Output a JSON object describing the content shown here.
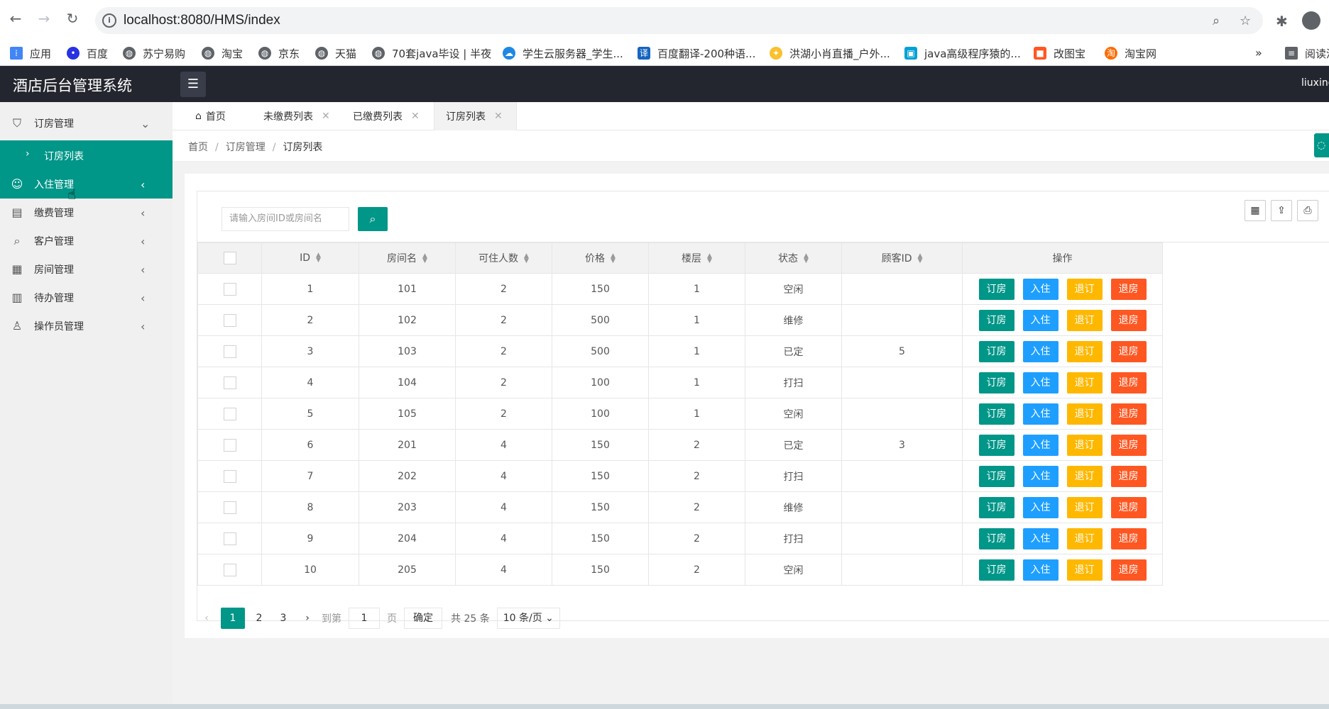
{
  "browser": {
    "url": "localhost:8080/HMS/index",
    "bookmarks": [
      "应用",
      "百度",
      "苏宁易购",
      "淘宝",
      "京东",
      "天猫",
      "70套java毕设 | 半夜",
      "学生云服务器_学生...",
      "百度翻译-200种语...",
      "洪湖小肖直播_户外...",
      "java高级程序猿的...",
      "改图宝",
      "淘宝网"
    ],
    "reading_list": "阅读清"
  },
  "app": {
    "title": "酒店后台管理系统",
    "user": "liuxing"
  },
  "sidebar": {
    "items": [
      {
        "label": "订房管理"
      },
      {
        "label": "入住管理"
      },
      {
        "label": "缴费管理"
      },
      {
        "label": "客户管理"
      },
      {
        "label": "房间管理"
      },
      {
        "label": "待办管理"
      },
      {
        "label": "操作员管理"
      }
    ],
    "sub_item": "订房列表"
  },
  "tabs": [
    "首页",
    "未缴费列表",
    "已缴费列表",
    "订房列表"
  ],
  "breadcrumb": [
    "首页",
    "订房管理",
    "订房列表"
  ],
  "search": {
    "placeholder": "请输入房间ID或房间名"
  },
  "table": {
    "columns": [
      "ID",
      "房间名",
      "可住人数",
      "价格",
      "楼层",
      "状态",
      "顾客ID",
      "操作"
    ],
    "actions": [
      "订房",
      "入住",
      "退订",
      "退房"
    ],
    "rows": [
      [
        "1",
        "101",
        "2",
        "150",
        "1",
        "空闲",
        ""
      ],
      [
        "2",
        "102",
        "2",
        "500",
        "1",
        "维修",
        ""
      ],
      [
        "3",
        "103",
        "2",
        "500",
        "1",
        "已定",
        "5"
      ],
      [
        "4",
        "104",
        "2",
        "100",
        "1",
        "打扫",
        ""
      ],
      [
        "5",
        "105",
        "2",
        "100",
        "1",
        "空闲",
        ""
      ],
      [
        "6",
        "201",
        "4",
        "150",
        "2",
        "已定",
        "3"
      ],
      [
        "7",
        "202",
        "4",
        "150",
        "2",
        "打扫",
        ""
      ],
      [
        "8",
        "203",
        "4",
        "150",
        "2",
        "维修",
        ""
      ],
      [
        "9",
        "204",
        "4",
        "150",
        "2",
        "打扫",
        ""
      ],
      [
        "10",
        "205",
        "4",
        "150",
        "2",
        "空闲",
        ""
      ]
    ]
  },
  "pagination": {
    "pages": [
      "1",
      "2",
      "3"
    ],
    "goto_label": "到第",
    "goto_value": "1",
    "page_unit": "页",
    "confirm": "确定",
    "total": "共 25 条",
    "limit": "10 条/页"
  }
}
